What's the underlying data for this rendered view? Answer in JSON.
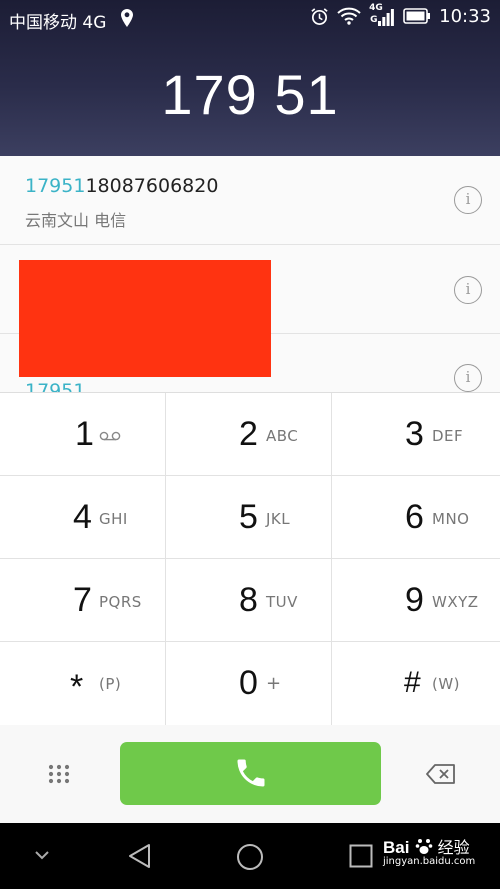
{
  "status_bar": {
    "carrier": "中国移动 4G",
    "signal_tag_top": "4G",
    "signal_tag_bottom": "G",
    "time": "10:33"
  },
  "dialer": {
    "entered_number": "179 51"
  },
  "suggestions": [
    {
      "prefix": "17951",
      "rest": "18087606820",
      "location": "云南文山 电信"
    },
    {
      "prefix": "",
      "rest": "",
      "location": ""
    },
    {
      "prefix": "17951",
      "rest": "",
      "location": ""
    }
  ],
  "info_glyph": "i",
  "keys": [
    {
      "digit": "1",
      "letters": "",
      "icon": "voicemail-icon"
    },
    {
      "digit": "2",
      "letters": "ABC"
    },
    {
      "digit": "3",
      "letters": "DEF"
    },
    {
      "digit": "4",
      "letters": "GHI"
    },
    {
      "digit": "5",
      "letters": "JKL"
    },
    {
      "digit": "6",
      "letters": "MNO"
    },
    {
      "digit": "7",
      "letters": "PQRS"
    },
    {
      "digit": "8",
      "letters": "TUV"
    },
    {
      "digit": "9",
      "letters": "WXYZ"
    },
    {
      "digit": "*",
      "letters": "(P)"
    },
    {
      "digit": "0",
      "letters": "+"
    },
    {
      "digit": "#",
      "letters": "(W)"
    }
  ],
  "watermark": {
    "logo": "Bai",
    "logo_suffix": "经验",
    "url": "jingyan.baidu.com"
  },
  "colors": {
    "match_highlight": "#3bb3c7",
    "call_button": "#6fc94a",
    "redaction": "#ff3311",
    "header_bg": "#22243e"
  },
  "icons": [
    "location-icon",
    "alarm-icon",
    "wifi-icon",
    "signal-icon",
    "battery-icon",
    "info-icon",
    "keypad-toggle-icon",
    "phone-icon",
    "backspace-icon",
    "chevron-down-icon",
    "back-icon",
    "home-icon",
    "recents-icon",
    "paw-icon"
  ]
}
